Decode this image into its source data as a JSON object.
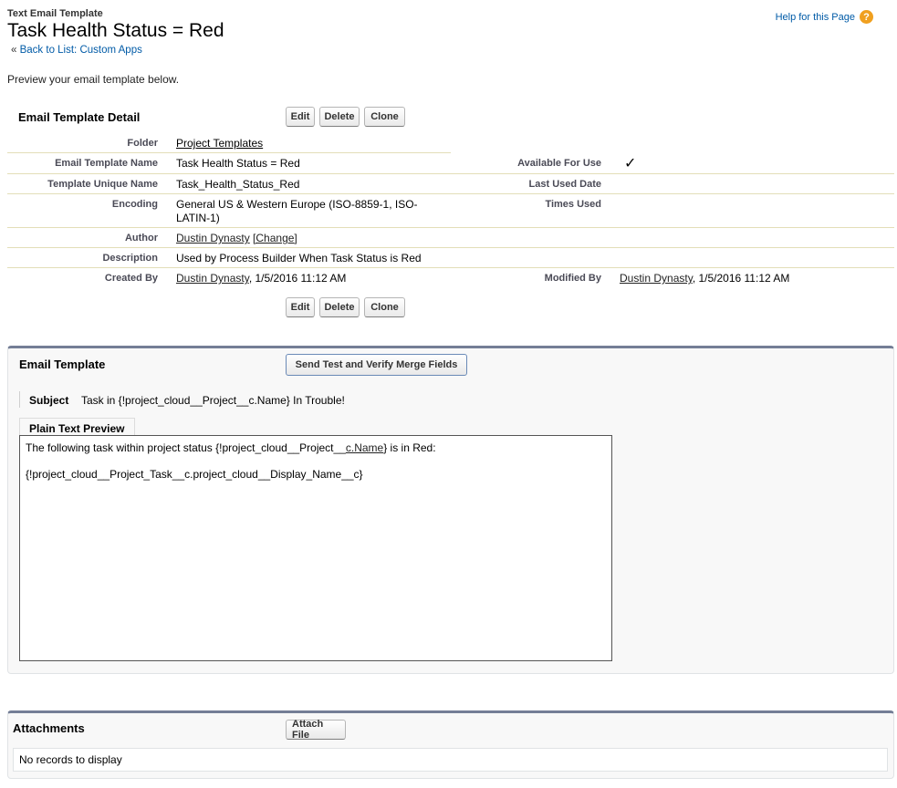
{
  "header": {
    "eyebrow": "Text Email Template",
    "title": "Task Health Status = Red",
    "back_prefix": "«",
    "back_link": "Back to List: Custom Apps",
    "help": "Help for this Page",
    "help_icon": "?"
  },
  "intro": "Preview your email template below.",
  "detail": {
    "title": "Email Template Detail",
    "buttons": {
      "edit": "Edit",
      "delete": "Delete",
      "clone": "Clone"
    },
    "fields": {
      "folder_label": "Folder",
      "folder_value": "Project Templates",
      "name_label": "Email Template Name",
      "name_value": "Task Health Status = Red",
      "unique_label": "Template Unique Name",
      "unique_value": "Task_Health_Status_Red",
      "encoding_label": "Encoding",
      "encoding_value_line1": "General US & Western Europe (ISO-8859-1, ISO-",
      "encoding_value_line2": "LATIN-1)",
      "author_label": "Author",
      "author_value": "Dustin Dynasty",
      "author_change": "[Change]",
      "description_label": "Description",
      "description_value": "Used by Process Builder When Task Status is Red",
      "created_label": "Created By",
      "created_user": "Dustin Dynasty",
      "created_date": ", 1/5/2016 11:12 AM",
      "available_label": "Available For Use",
      "available_value": "✓",
      "last_used_label": "Last Used Date",
      "times_used_label": "Times Used",
      "modified_label": "Modified By",
      "modified_user": "Dustin Dynasty",
      "modified_date": ", 1/5/2016 11:12 AM"
    }
  },
  "email_template": {
    "title": "Email Template",
    "send_test_button": "Send Test and Verify Merge Fields",
    "subject_label": "Subject",
    "subject_value": "Task in {!project_cloud__Project__c.Name} In Trouble!",
    "preview_tab": "Plain Text Preview",
    "body_line1_pre": "The following task within project status {!project_cloud__Project__",
    "body_line1_link": "c.Name",
    "body_line1_post": "} is in Red:",
    "body_line2": "{!project_cloud__Project_Task__c.project_cloud__Display_Name__c}"
  },
  "attachments": {
    "title": "Attachments",
    "attach_button": "Attach File",
    "empty_text": "No records to display"
  }
}
